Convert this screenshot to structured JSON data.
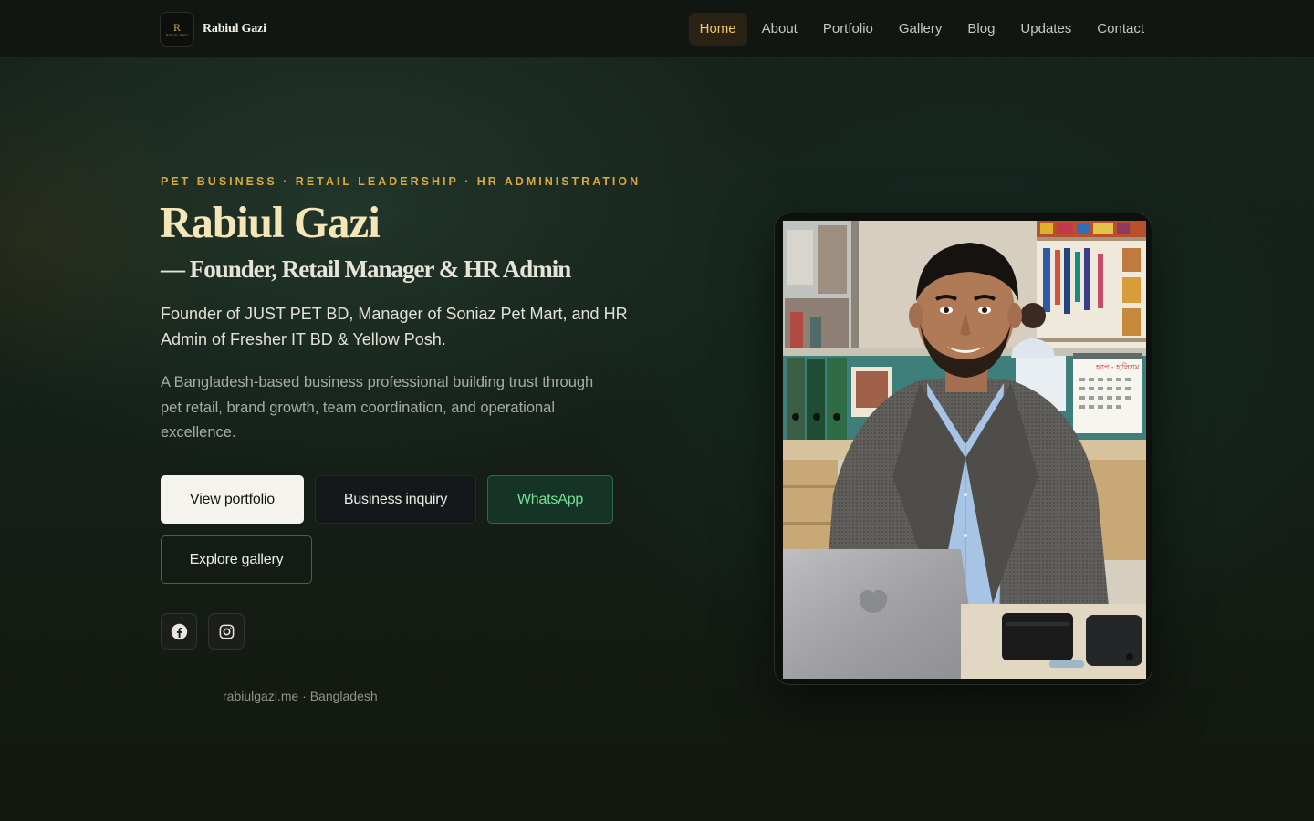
{
  "brand": {
    "name": "Rabiul Gazi",
    "logo_monogram": "R",
    "logo_tagline": "RABIUL GAZI"
  },
  "nav": {
    "items": [
      {
        "label": "Home",
        "active": true
      },
      {
        "label": "About"
      },
      {
        "label": "Portfolio"
      },
      {
        "label": "Gallery"
      },
      {
        "label": "Blog"
      },
      {
        "label": "Updates"
      },
      {
        "label": "Contact"
      }
    ]
  },
  "hero": {
    "kicker": "PET BUSINESS · RETAIL LEADERSHIP · HR ADMINISTRATION",
    "title": "Rabiul Gazi",
    "subtitle": "— Founder, Retail Manager & HR Admin",
    "lead": "Founder of JUST PET BD, Manager of Soniaz Pet Mart, and HR Admin of Fresher IT BD & Yellow Posh.",
    "description": "A Bangladesh-based business professional building trust through pet retail, brand growth, team coordination, and operational excellence.",
    "buttons": {
      "view_portfolio": "View portfolio",
      "business_inquiry": "Business inquiry",
      "whatsapp": "WhatsApp",
      "explore_gallery": "Explore gallery"
    },
    "site_note": "rabiulgazi.me · Bangladesh",
    "calendar_text": "হ্যাপ - হালিশ্রম"
  },
  "social": [
    {
      "icon": "facebook-icon"
    },
    {
      "icon": "instagram-icon"
    }
  ],
  "colors": {
    "accent_gold": "#d9a93f",
    "title_cream": "#f5e6b8",
    "whatsapp_green": "#73e09a",
    "nav_active_bg": "#2a2214"
  }
}
